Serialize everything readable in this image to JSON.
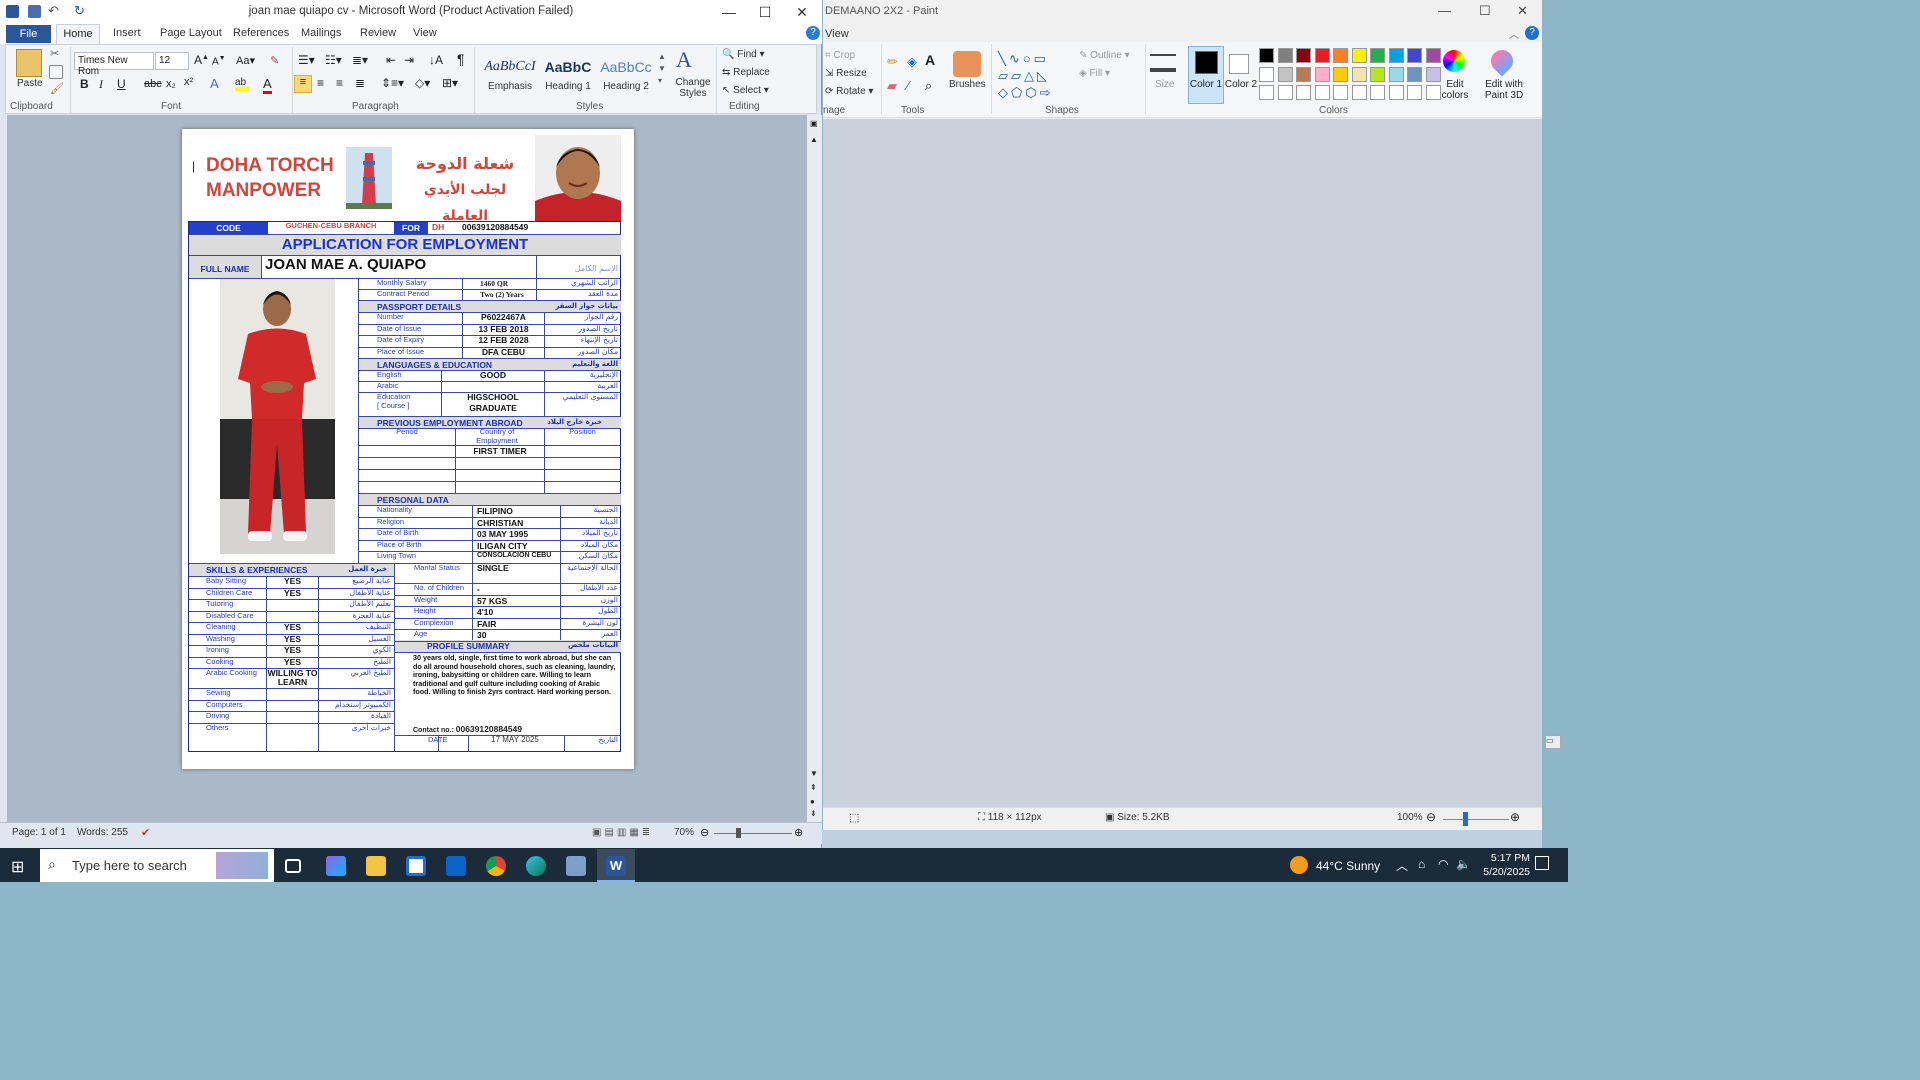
{
  "word": {
    "title": "joan mae quiapo cv  -  Microsoft Word (Product Activation Failed)",
    "tabs": [
      "File",
      "Home",
      "Insert",
      "Page Layout",
      "References",
      "Mailings",
      "Review",
      "View"
    ],
    "font_name": "Times New Rom",
    "font_size": "12",
    "clipboard": {
      "paste": "Paste",
      "group": "Clipboard"
    },
    "groups": {
      "font": "Font",
      "paragraph": "Paragraph",
      "styles": "Styles",
      "editing": "Editing"
    },
    "styles": [
      {
        "preview": "AaBbCcI",
        "name": "Emphasis"
      },
      {
        "preview": "AaBbC",
        "name": "Heading 1"
      },
      {
        "preview": "AaBbCc",
        "name": "Heading 2"
      }
    ],
    "change_styles": "Change Styles",
    "editing": {
      "find": "Find",
      "replace": "Replace",
      "select": "Select"
    },
    "status": {
      "page": "Page: 1 of 1",
      "words": "Words: 255",
      "zoom": "70%"
    }
  },
  "cv": {
    "company_en_1": "DOHA TORCH",
    "company_en_2": "MANPOWER",
    "company_ar_1": "شعلة الدوحة",
    "company_ar_2": "لجلب الأيدي العاملة",
    "code_label": "CODE",
    "code_value": "GUCHEN-CEBU BRANCH",
    "for_label": "FOR",
    "for_value": "DH",
    "phone": "00639120884549",
    "app_title": "APPLICATION FOR EMPLOYMENT",
    "fullname_label": "FULL NAME",
    "fullname": "JOAN MAE A. QUIAPO",
    "fullname_ar": "الإسم الكامل",
    "salary_label": "Monthly Salary",
    "salary": "1460 QR",
    "salary_ar": "الراتب الشهري",
    "contract_label": "Contract Period",
    "contract": "Two (2) Years",
    "contract_ar": "مدة العقد",
    "passport_hd": "PASSPORT DETAILS",
    "passport_hd_ar": "بيانات جواز السفر",
    "passport_rows": [
      {
        "en": "Number",
        "val": "P6022467A",
        "ar": "رقم الجواز"
      },
      {
        "en": "Date of Issue",
        "val": "13 FEB 2018",
        "ar": "تاريخ الصدور"
      },
      {
        "en": "Date of Expiry",
        "val": "12 FEB 2028",
        "ar": "تاريخ الإنتهاء"
      },
      {
        "en": "Place of Issue",
        "val": "DFA CEBU",
        "ar": "مكان الصدور"
      }
    ],
    "lang_hd": "LANGUAGES & EDUCATION",
    "lang_hd_ar": "اللغة والتعليم",
    "lang_rows": [
      {
        "en": "English",
        "val": "GOOD",
        "ar": "الإنجليزية"
      },
      {
        "en": "Arabic",
        "val": "",
        "ar": "العربية"
      }
    ],
    "edu_label_1": "Education",
    "edu_label_2": "[ Course ]",
    "edu_val_1": "HIGSCHOOL",
    "edu_val_2": "GRADUATE",
    "edu_ar": "المستوى التعليمي",
    "prev_hd": "PREVIOUS EMPLOYMENT ABROAD",
    "prev_hd_ar": "خبرة خارج البلاد",
    "prev_cols": [
      "Period",
      "Country of Employment",
      "Position"
    ],
    "prev_value": "FIRST TIMER",
    "personal_hd": "PERSONAL DATA",
    "personal_rows": [
      {
        "en": "Nationality",
        "val": "FILIPINO",
        "ar": "الجنسية"
      },
      {
        "en": "Religion",
        "val": "CHRISTIAN",
        "ar": "الديانة"
      },
      {
        "en": "Date of Birth",
        "val": "03 MAY 1995",
        "ar": "تاريخ الميلاد"
      },
      {
        "en": "Place of Birth",
        "val": "ILIGAN CITY",
        "ar": "مكان الميلاد"
      },
      {
        "en": "Living Town",
        "val": "CONSOLACION CEBU",
        "ar": "مكان السكن"
      }
    ],
    "marital_label": "Marital Status",
    "marital": "SINGLE",
    "marital_ar": "الحالة الإجتماعية",
    "body_rows": [
      {
        "en": "No. of Children",
        "val": "-",
        "ar": "عدد الأطفال"
      },
      {
        "en": "Weight",
        "val": "57 KGS",
        "ar": "الوزن"
      },
      {
        "en": "Height",
        "val": "4'10",
        "ar": "الطول"
      },
      {
        "en": "Complexion",
        "val": "FAIR",
        "ar": "لون البشرة"
      },
      {
        "en": "Age",
        "val": "30",
        "ar": "العمر"
      }
    ],
    "skills_hd": "SKILLS & EXPERIENCES",
    "skills_hd_ar": "خبرة العمل",
    "skills": [
      {
        "en": "Baby Sitting",
        "val": "YES",
        "ar": "عناية الرضيع"
      },
      {
        "en": "Children Care",
        "val": "YES",
        "ar": "عناية الأطفال"
      },
      {
        "en": "Tutoring",
        "val": "",
        "ar": "تعليم الأطفال"
      },
      {
        "en": "Disabled Care",
        "val": "",
        "ar": "عناية العجزة"
      },
      {
        "en": "Cleaning",
        "val": "YES",
        "ar": "التنظيف"
      },
      {
        "en": "Washing",
        "val": "YES",
        "ar": "الغسيل"
      },
      {
        "en": "Ironing",
        "val": "YES",
        "ar": "الكوي"
      },
      {
        "en": "Cooking",
        "val": "YES",
        "ar": "الطبخ"
      },
      {
        "en": "Arabic Cooking",
        "val": "WILLING TO LEARN",
        "ar": "الطبخ العربي"
      },
      {
        "en": "Sewing",
        "val": "",
        "ar": "الخياطة"
      },
      {
        "en": "Computers",
        "val": "",
        "ar": "الكمبيوتر إستخدام"
      },
      {
        "en": "Driving",
        "val": "",
        "ar": "القيادة"
      },
      {
        "en": "Others",
        "val": "",
        "ar": "خبرات أخرى"
      }
    ],
    "profile_hd": "PROFILE SUMMARY",
    "profile_hd_ar": "البيانات ملخص",
    "profile_text": "30 years old, single, first time to work abroad, but she can do all around household chores, such as cleaning, laundry, ironing, babysitting or children care. Willing to learn traditional and gulf culture including cooking of Arabic food. Willing to finish 2yrs contract. Hard working person.",
    "contact_label": "Contact no.:",
    "contact": "00639120884549",
    "date_label": "DATE",
    "date": "17 MAY 2025",
    "date_ar": "التاريخ"
  },
  "paint": {
    "title": "DEMAANO 2X2 - Paint",
    "view_tab": "View",
    "image_tools": {
      "crop": "Crop",
      "resize": "Resize",
      "rotate": "Rotate",
      "group": "nage"
    },
    "tools_group": "Tools",
    "brushes": "Brushes",
    "shapes_group": "Shapes",
    "outline": "Outline",
    "fill": "Fill",
    "size": "Size",
    "color1": "Color 1",
    "color2": "Color 2",
    "colors_group": "Colors",
    "edit_colors": "Edit colors",
    "edit_3d": "Edit with Paint 3D",
    "palette": [
      "#000000",
      "#7f7f7f",
      "#880015",
      "#ed1c24",
      "#ff7f27",
      "#fff200",
      "#22b14c",
      "#00a2e8",
      "#3f48cc",
      "#a349a4",
      "#ffffff",
      "#c3c3c3",
      "#b97a57",
      "#ffaec9",
      "#ffc90e",
      "#efe4b0",
      "#b5e61d",
      "#99d9ea",
      "#7092be",
      "#c8bfe7"
    ],
    "dimensions": "118 × 112px",
    "filesize": "Size: 5.2KB",
    "zoom": "100%"
  },
  "taskbar": {
    "search_placeholder": "Type here to search",
    "weather": "44°C  Sunny",
    "time": "5:17 PM",
    "date": "5/20/2025"
  }
}
